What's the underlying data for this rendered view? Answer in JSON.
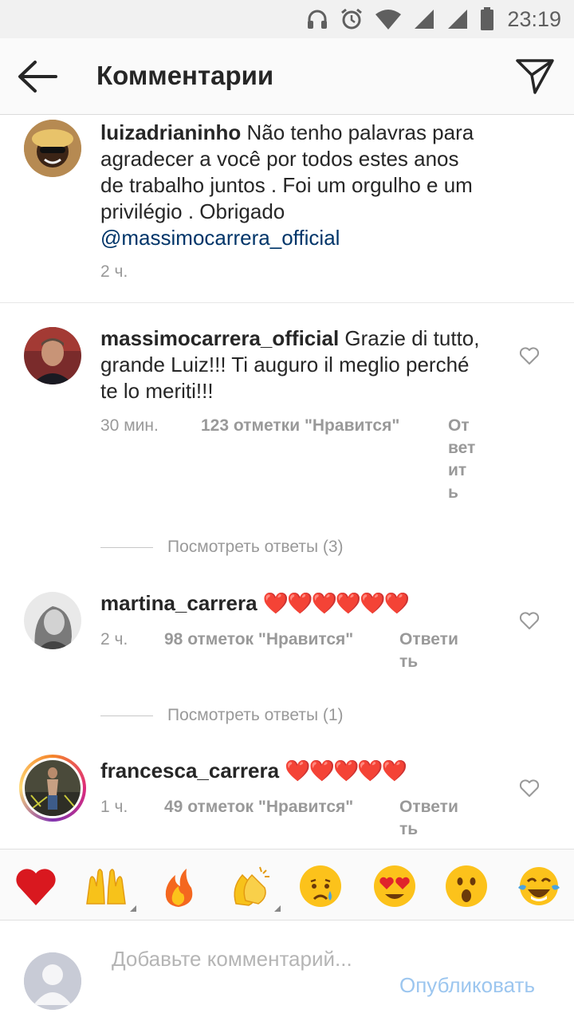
{
  "status_bar": {
    "time": "23:19"
  },
  "header": {
    "title": "Комментарии"
  },
  "comments": [
    {
      "username": "luizadrianinho",
      "text": " Não tenho palavras para agradecer a você por todos estes anos de trabalho juntos . Foi um orgulho e um privilégio . Obrigado ",
      "mention": "@massimocarrera_official",
      "time": "2 ч."
    },
    {
      "username": "massimocarrera_official",
      "text": " Grazie di tutto, grande Luiz!!! Ti auguro il meglio perché te lo meriti!!!",
      "time": "30 мин.",
      "likes": "123 отметки \"Нравится\"",
      "reply": "Ответить",
      "view_replies": "Посмотреть ответы (3)"
    },
    {
      "username": "martina_carrera",
      "text": "❤️❤️❤️❤️❤️❤️",
      "time": "2 ч.",
      "likes": "98 отметок \"Нравится\"",
      "reply": "Ответить",
      "view_replies": "Посмотреть ответы (1)"
    },
    {
      "username": "francesca_carrera",
      "text": "❤️❤️❤️❤️❤️",
      "time": "1 ч.",
      "likes": "49 отметок \"Нравится\"",
      "reply": "Ответить"
    }
  ],
  "emoji_bar": [
    "red-heart",
    "raising-hands",
    "fire",
    "clapping-hands",
    "crying-face",
    "heart-eyes-face",
    "astonished-face",
    "tears-of-joy-face"
  ],
  "composer": {
    "placeholder": "Добавьте комментарий...",
    "publish_label": "Опубликовать"
  },
  "colors": {
    "mention": "#003569",
    "publish": "#9cc6ef",
    "meta": "#999999"
  }
}
